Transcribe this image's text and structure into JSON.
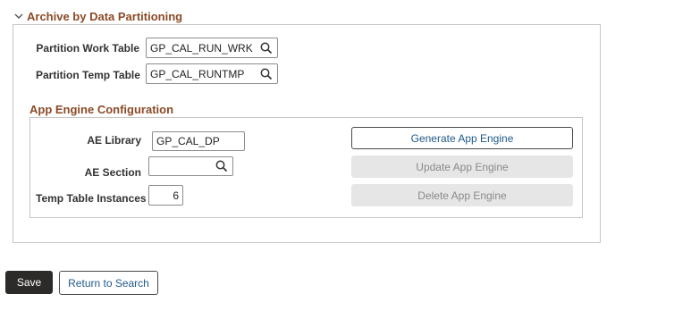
{
  "section": {
    "title": "Archive by Data Partitioning",
    "icon": "chevron-down-icon"
  },
  "partition": {
    "work_table_label": "Partition Work Table",
    "work_table_value": "GP_CAL_RUN_WRK",
    "temp_table_label": "Partition Temp Table",
    "temp_table_value": "GP_CAL_RUNTMP"
  },
  "app_engine": {
    "title": "App Engine Configuration",
    "library_label": "AE Library",
    "library_value": "GP_CAL_DP",
    "section_label": "AE Section",
    "section_value": "",
    "instances_label": "Temp Table Instances",
    "instances_value": "6",
    "generate_label": "Generate App Engine",
    "update_label": "Update App Engine",
    "delete_label": "Delete App Engine"
  },
  "footer": {
    "save_label": "Save",
    "return_label": "Return to Search"
  },
  "colors": {
    "section_title": "#8b4a26",
    "link": "#1f5a8a",
    "save_bg": "#2d2b2a",
    "disabled_bg": "#e6e6e6"
  }
}
